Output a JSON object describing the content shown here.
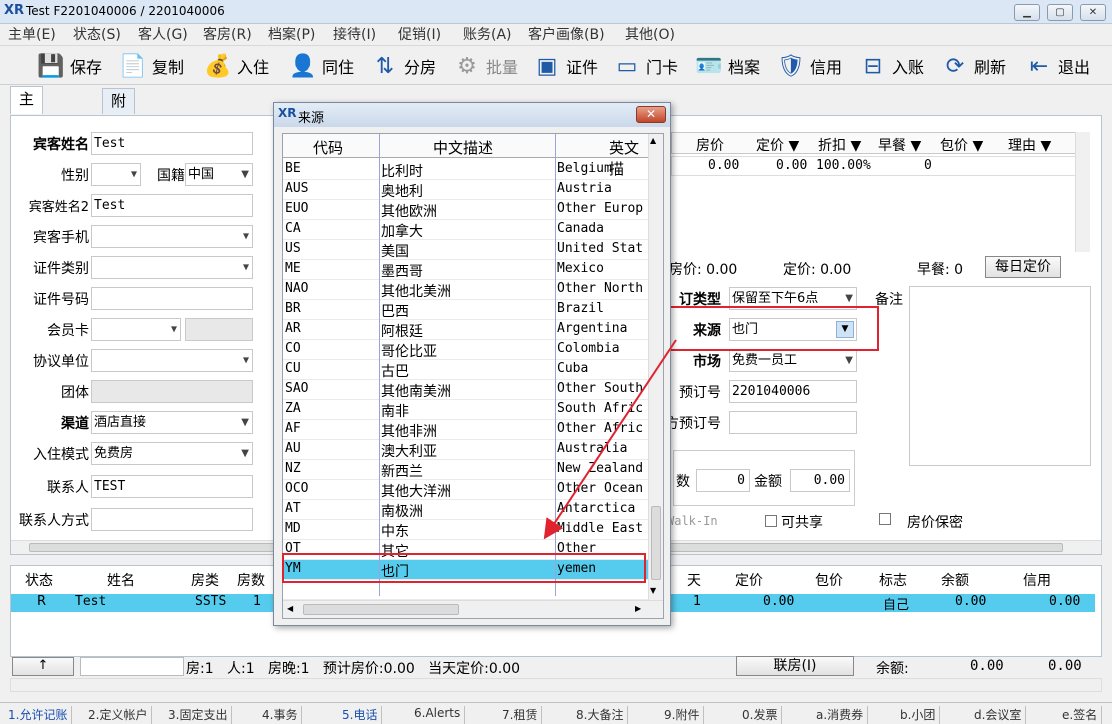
{
  "window": {
    "logo": "XR",
    "title": "Test F2201040006 / 2201040006"
  },
  "menu": [
    "主单(E)",
    "状态(S)",
    "客人(G)",
    "客房(R)",
    "档案(P)",
    "接待(I)",
    "促销(I)",
    "账务(A)",
    "客户画像(B)",
    "其他(O)"
  ],
  "toolbar": [
    {
      "label": "保存",
      "icon": "save-icon"
    },
    {
      "label": "复制",
      "icon": "copy-icon"
    },
    {
      "label": "入住",
      "icon": "money-bag-icon"
    },
    {
      "label": "同住",
      "icon": "person-icon"
    },
    {
      "label": "分房",
      "icon": "split-icon"
    },
    {
      "label": "批量",
      "icon": "gear-icon"
    },
    {
      "label": "证件",
      "icon": "id-icon"
    },
    {
      "label": "门卡",
      "icon": "card-icon"
    },
    {
      "label": "档案",
      "icon": "profile-icon"
    },
    {
      "label": "信用",
      "icon": "shield-icon"
    },
    {
      "label": "入账",
      "icon": "post-icon"
    },
    {
      "label": "刷新",
      "icon": "refresh-icon"
    },
    {
      "label": "退出",
      "icon": "exit-icon"
    }
  ],
  "tabs": [
    "主要信息",
    "附加信息"
  ],
  "form": {
    "guest_name_label": "宾客姓名",
    "guest_name": "Test",
    "gender_label": "性别",
    "nationality_label": "国籍",
    "nationality": "中国",
    "guest_name2_label": "宾客姓名2",
    "guest_name2": "Test",
    "mobile_label": "宾客手机",
    "id_type_label": "证件类别",
    "id_no_label": "证件号码",
    "member_card_label": "会员卡",
    "agreement_label": "协议单位",
    "group_label": "团体",
    "channel_label": "渠道",
    "channel": "酒店直接",
    "checkin_mode_label": "入住模式",
    "checkin_mode": "免费房",
    "contact_label": "联系人",
    "contact": "TEST",
    "contact_method_label": "联系人方式"
  },
  "rate_grid": {
    "headers": [
      "房价",
      "定价 ▼",
      "折扣 ▼",
      "早餐 ▼",
      "包价 ▼",
      "理由 ▼"
    ],
    "row": [
      "0.00",
      "0.00",
      "100.00%",
      "0",
      "",
      ""
    ]
  },
  "summary": {
    "room_rate": "房价: 0.00",
    "set_rate": "定价: 0.00",
    "breakfast": "早餐: 0",
    "daily_rate_btn": "每日定价"
  },
  "booking": {
    "booking_type_label": "订类型",
    "booking_type": "保留至下午6点",
    "source_label": "来源",
    "source": "也门",
    "market_label": "市场",
    "market": "免费一员工",
    "booking_no_label": "预订号",
    "booking_no": "2201040006",
    "ext_booking_label": "方预订号",
    "remark_label": "备注",
    "count_label": "数",
    "count": "0",
    "amount_label": "金额",
    "amount": "0.00",
    "walkin": "Walk-In",
    "shareable": "可共享",
    "rate_secret": "房价保密"
  },
  "status_grid": {
    "headers": [
      "状态",
      "姓名",
      "房类",
      "房数"
    ],
    "headers_right": [
      "天",
      "定价",
      "包价",
      "标志",
      "余额",
      "信用"
    ],
    "row": {
      "status": "R",
      "name": "Test",
      "type": "SSTS",
      "rooms": "1",
      "days": "1",
      "rate": "0.00",
      "flag": "自己",
      "balance": "0.00",
      "credit": "0.00"
    },
    "footer": "房:1   人:1   房晚:1   预计房价:0.00   当天定价:0.00",
    "up_btn": "↑",
    "link_btn": "联房(I)",
    "balance_label": "余额:",
    "balance1": "0.00",
    "balance2": "0.00"
  },
  "bottom_tabs": [
    "1.允许记账",
    "2.定义帐户",
    "3.固定支出",
    "4.事务",
    "5.电话",
    "6.Alerts",
    "7.租赁",
    "8.大备注",
    "9.附件",
    "0.发票",
    "a.消费券",
    "b.小团",
    "d.会议室",
    "e.签名"
  ],
  "dialog": {
    "title": "来源",
    "headers": [
      "代码",
      "中文描述",
      "英文描"
    ],
    "rows": [
      [
        "BE",
        "比利时",
        "Belgium"
      ],
      [
        "AUS",
        "奥地利",
        "Austria"
      ],
      [
        "EUO",
        "其他欧洲",
        "Other Europ"
      ],
      [
        "CA",
        "加拿大",
        "Canada"
      ],
      [
        "US",
        "美国",
        "United Stat"
      ],
      [
        "ME",
        "墨西哥",
        "Mexico"
      ],
      [
        "NAO",
        "其他北美洲",
        "Other North"
      ],
      [
        "BR",
        "巴西",
        "Brazil"
      ],
      [
        "AR",
        "阿根廷",
        "Argentina"
      ],
      [
        "CO",
        "哥伦比亚",
        "Colombia"
      ],
      [
        "CU",
        "古巴",
        "Cuba"
      ],
      [
        "SAO",
        "其他南美洲",
        "Other South"
      ],
      [
        "ZA",
        "南非",
        "South Afric"
      ],
      [
        "AF",
        "其他非洲",
        "Other Afric"
      ],
      [
        "AU",
        "澳大利亚",
        "Australia"
      ],
      [
        "NZ",
        "新西兰",
        "New Zealand"
      ],
      [
        "OCO",
        "其他大洋洲",
        "Other Ocean"
      ],
      [
        "AT",
        "南极洲",
        "Antarctica"
      ],
      [
        "MD",
        "中东",
        "Middle East"
      ],
      [
        "OT",
        "其它",
        "Other"
      ],
      [
        "YM",
        "也门",
        "yemen"
      ]
    ],
    "selected_index": 20
  },
  "colors": {
    "highlight": "#55ccee",
    "annotation": "#e0232f"
  }
}
